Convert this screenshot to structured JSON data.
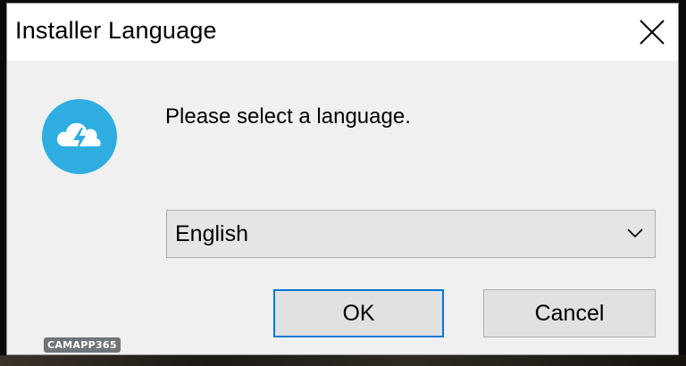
{
  "window": {
    "title": "Installer Language",
    "close_icon": "close-icon"
  },
  "dialog": {
    "app_icon": "cloud-lightning-icon",
    "prompt": "Please select a language.",
    "language_select": {
      "selected": "English",
      "dropdown_icon": "chevron-down-icon"
    },
    "buttons": {
      "ok_label": "OK",
      "cancel_label": "Cancel"
    }
  },
  "watermark": {
    "text": "CAMAPP365"
  },
  "colors": {
    "dialog_bg": "#f0f0f0",
    "title_bg": "#ffffff",
    "icon_blue": "#2eaee0",
    "focus_border": "#0078d7",
    "button_bg": "#e1e1e1"
  }
}
